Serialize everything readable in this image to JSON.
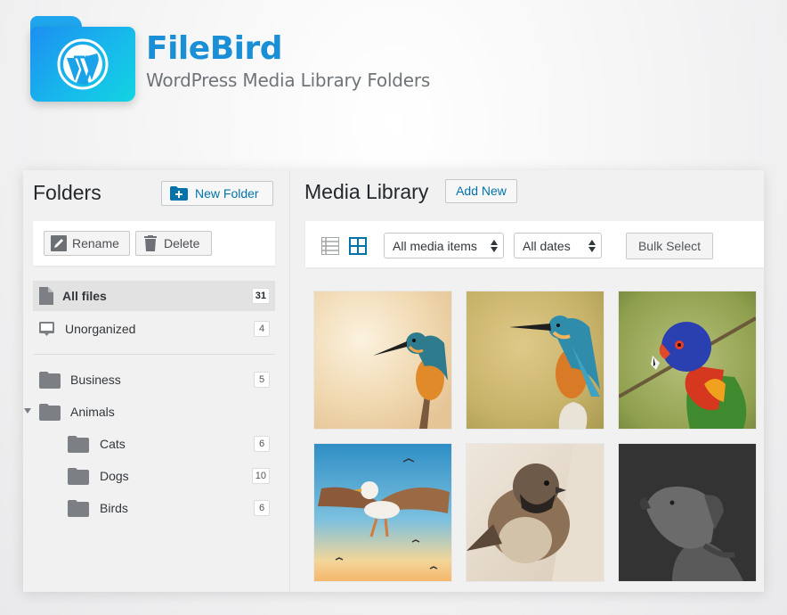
{
  "brand": {
    "title": "FileBird",
    "subtitle": "WordPress Media Library Folders",
    "logo_icon": "wordpress-folder-icon"
  },
  "sidebar": {
    "title": "Folders",
    "new_folder_label": "New Folder",
    "rename_label": "Rename",
    "delete_label": "Delete",
    "special": [
      {
        "label": "All files",
        "count": "31",
        "icon": "file-icon",
        "active": true
      },
      {
        "label": "Unorganized",
        "count": "4",
        "icon": "inbox-icon",
        "active": false
      }
    ],
    "folders": [
      {
        "label": "Business",
        "count": "5",
        "level": 0
      },
      {
        "label": "Animals",
        "count": "",
        "level": 0,
        "expanded": true
      },
      {
        "label": "Cats",
        "count": "6",
        "level": 1
      },
      {
        "label": "Dogs",
        "count": "10",
        "level": 1
      },
      {
        "label": "Birds",
        "count": "6",
        "level": 1
      }
    ]
  },
  "main": {
    "title": "Media Library",
    "add_new_label": "Add New",
    "filter_type": "All media items",
    "filter_date": "All dates",
    "bulk_select_label": "Bulk Select",
    "media": [
      {
        "name": "kingfisher-1",
        "subject": "kingfisher"
      },
      {
        "name": "kingfisher-2",
        "subject": "kingfisher"
      },
      {
        "name": "rainbow-lorikeet",
        "subject": "parrot"
      },
      {
        "name": "seagull",
        "subject": "gull"
      },
      {
        "name": "sparrow",
        "subject": "sparrow"
      },
      {
        "name": "dog-dark",
        "subject": "dog"
      }
    ]
  },
  "colors": {
    "accent": "#0073aa",
    "brand_blue": "#1a8fd6",
    "active_row": "#e2e2e2"
  }
}
